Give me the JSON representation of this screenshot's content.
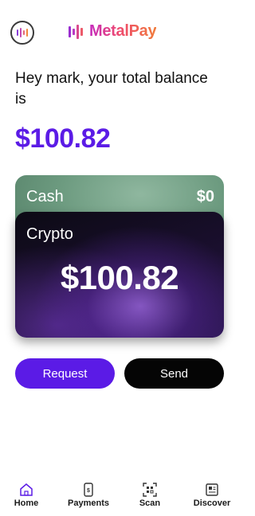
{
  "header": {
    "brand_name": "MetalPay",
    "avatar_icon": "waveform-icon",
    "logo_icon": "bars-logo-icon"
  },
  "greeting": "Hey mark, your total balance is",
  "total_balance": "$100.82",
  "cards": {
    "cash": {
      "label": "Cash",
      "amount": "$0"
    },
    "crypto": {
      "label": "Crypto",
      "amount": "$100.82"
    }
  },
  "actions": {
    "request_label": "Request",
    "send_label": "Send"
  },
  "tabs": [
    {
      "label": "Home",
      "icon": "home-icon"
    },
    {
      "label": "Payments",
      "icon": "phone-dollar-icon"
    },
    {
      "label": "Scan",
      "icon": "qr-scan-icon"
    },
    {
      "label": "Discover",
      "icon": "newspaper-icon"
    }
  ],
  "colors": {
    "accent": "#5b1be6",
    "send_button": "#050505",
    "cash_card": "#6d9b80",
    "crypto_card": "#1a0f2e"
  }
}
